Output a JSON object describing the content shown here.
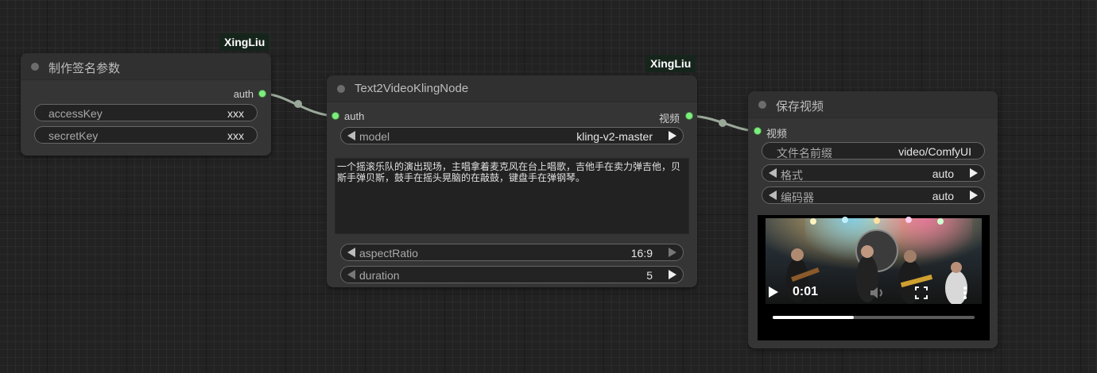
{
  "nodes": {
    "sign": {
      "badge": "XingLiu",
      "title": "制作签名参数",
      "output": "auth",
      "widgets": [
        {
          "label": "accessKey",
          "value": "xxx"
        },
        {
          "label": "secretKey",
          "value": "xxx"
        }
      ]
    },
    "t2v": {
      "badge": "XingLiu",
      "title": "Text2VideoKlingNode",
      "input": "auth",
      "output": "视频",
      "model": {
        "label": "model",
        "value": "kling-v2-master"
      },
      "prompt": "一个摇滚乐队的演出现场，主唱拿着麦克风在台上唱歌，吉他手在卖力弹吉他，贝斯手弹贝斯，鼓手在摇头晃脑的在敲鼓，键盘手在弹钢琴。",
      "aspectRatio": {
        "label": "aspectRatio",
        "value": "16:9"
      },
      "duration": {
        "label": "duration",
        "value": "5"
      }
    },
    "save": {
      "title": "保存视频",
      "input": "视频",
      "filename": {
        "label": "文件名前缀",
        "value": "video/ComfyUI"
      },
      "format": {
        "label": "格式",
        "value": "auto"
      },
      "codec": {
        "label": "编码器",
        "value": "auto"
      },
      "video": {
        "time": "0:01",
        "progress": 0.4
      }
    }
  },
  "colors": {
    "link": "#9aa89a",
    "slot": "#7bef7b",
    "badge_bg": "#16251c"
  }
}
